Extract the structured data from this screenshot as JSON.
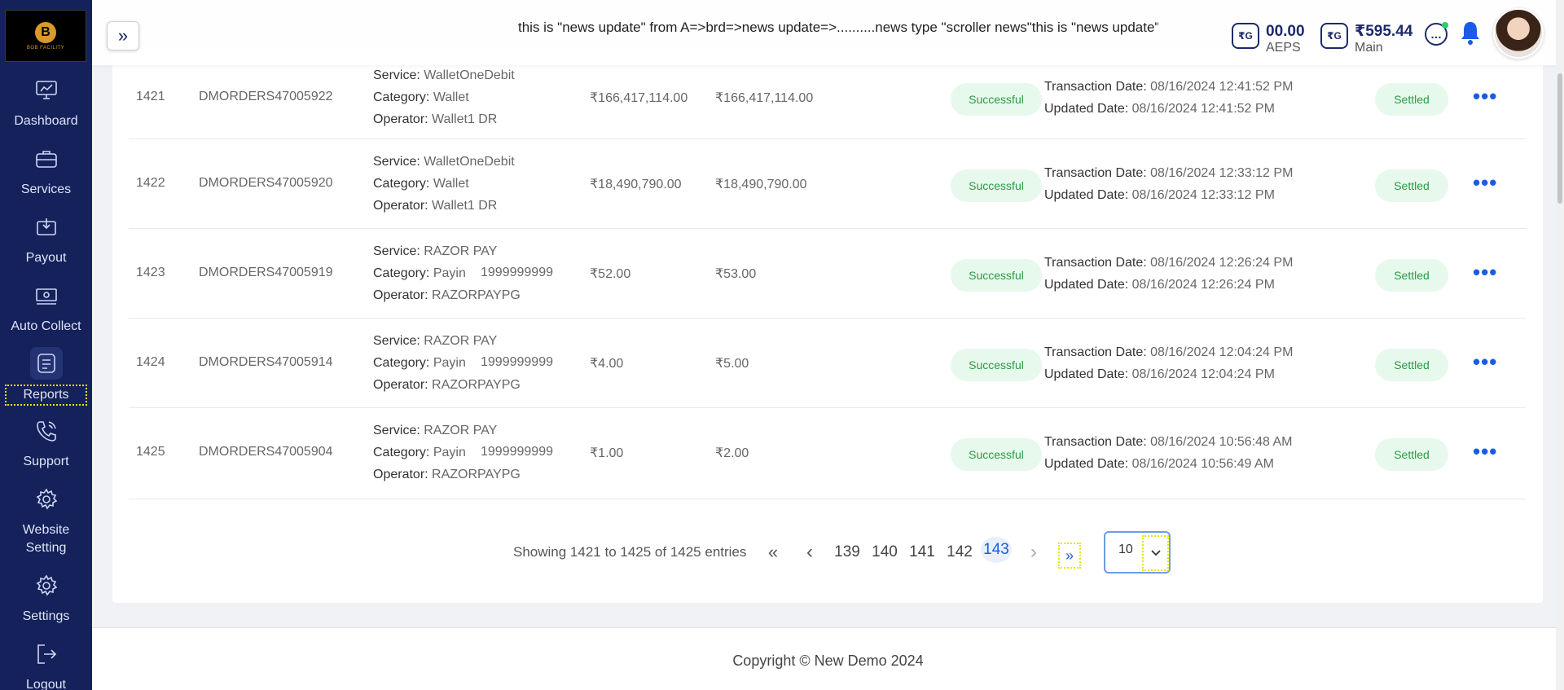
{
  "sidebar": {
    "logo_mark": "B",
    "logo_text": "BOB FACILITY",
    "items": [
      {
        "label": "Dashboard",
        "icon": "dashboard-icon"
      },
      {
        "label": "Services",
        "icon": "briefcase-icon"
      },
      {
        "label": "Payout",
        "icon": "payout-icon"
      },
      {
        "label": "Auto Collect",
        "icon": "cash-icon"
      },
      {
        "label": "Reports",
        "icon": "reports-icon"
      },
      {
        "label": "Support",
        "icon": "phone-icon"
      },
      {
        "label": "Website Setting",
        "icon": "gear-icon"
      },
      {
        "label": "Settings",
        "icon": "gear-icon"
      },
      {
        "label": "Logout",
        "icon": "logout-icon"
      }
    ],
    "active": "Reports"
  },
  "header": {
    "toggle_symbol": "»",
    "ticker": "this is \"news update\" from A=>brd=>news update=>..........news type \"scroller news\"this is \"news update\" from A=>brd=>news update=>..........news type \"scroller news\"",
    "wallets": [
      {
        "icon_text": "₹G",
        "amount": "00.00",
        "label": "AEPS"
      },
      {
        "icon_text": "₹G",
        "amount": "₹595.44",
        "label": "Main"
      }
    ]
  },
  "rows": [
    {
      "id": "1421",
      "order": "DMORDERS47005922",
      "service": "WalletOneDebit",
      "category": "Wallet",
      "operator": "Wallet1 DR",
      "number": "",
      "amount": "₹166,417,114.00",
      "total": "₹166,417,114.00",
      "status": "Successful",
      "transaction_date": "08/16/2024 12:41:52 PM",
      "updated_date": "08/16/2024 12:41:52 PM",
      "settlement": "Settled"
    },
    {
      "id": "1422",
      "order": "DMORDERS47005920",
      "service": "WalletOneDebit",
      "category": "Wallet",
      "operator": "Wallet1 DR",
      "number": "",
      "amount": "₹18,490,790.00",
      "total": "₹18,490,790.00",
      "status": "Successful",
      "transaction_date": "08/16/2024 12:33:12 PM",
      "updated_date": "08/16/2024 12:33:12 PM",
      "settlement": "Settled"
    },
    {
      "id": "1423",
      "order": "DMORDERS47005919",
      "service": "RAZOR PAY",
      "category": "Payin",
      "operator": "RAZORPAYPG",
      "number": "1999999999",
      "amount": "₹52.00",
      "total": "₹53.00",
      "status": "Successful",
      "transaction_date": "08/16/2024 12:26:24 PM",
      "updated_date": "08/16/2024 12:26:24 PM",
      "settlement": "Settled"
    },
    {
      "id": "1424",
      "order": "DMORDERS47005914",
      "service": "RAZOR PAY",
      "category": "Payin",
      "operator": "RAZORPAYPG",
      "number": "1999999999",
      "amount": "₹4.00",
      "total": "₹5.00",
      "status": "Successful",
      "transaction_date": "08/16/2024 12:04:24 PM",
      "updated_date": "08/16/2024 12:04:24 PM",
      "settlement": "Settled"
    },
    {
      "id": "1425",
      "order": "DMORDERS47005904",
      "service": "RAZOR PAY",
      "category": "Payin",
      "operator": "RAZORPAYPG",
      "number": "1999999999",
      "amount": "₹1.00",
      "total": "₹2.00",
      "status": "Successful",
      "transaction_date": "08/16/2024 10:56:48 AM",
      "updated_date": "08/16/2024 10:56:49 AM",
      "settlement": "Settled"
    }
  ],
  "labels": {
    "service": "Service:",
    "category": "Category:",
    "operator": "Operator:",
    "transaction_date": "Transaction Date:",
    "updated_date": "Updated Date:"
  },
  "pagination": {
    "summary": "Showing 1421 to 1425 of 1425 entries",
    "first": "«",
    "prev": "‹",
    "next": "›",
    "last": "»",
    "pages": [
      "139",
      "140",
      "141",
      "142",
      "143"
    ],
    "current_page": "143",
    "page_size": "10"
  },
  "footer": {
    "copyright": "Copyright © New Demo 2024"
  }
}
